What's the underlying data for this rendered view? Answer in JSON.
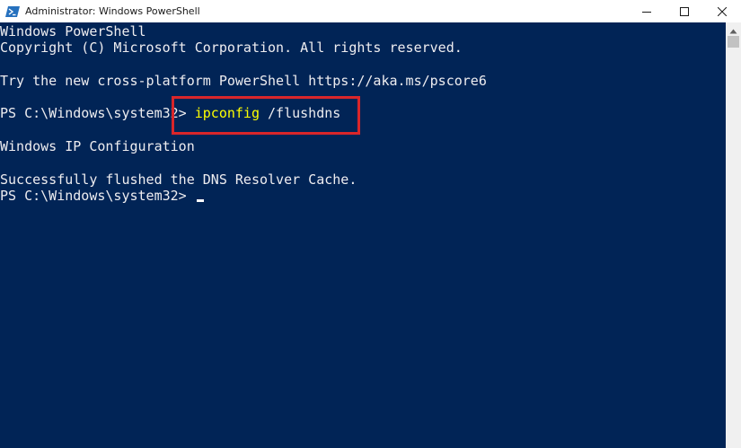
{
  "window": {
    "title": "Administrator: Windows PowerShell",
    "controls": [
      "minimize-icon",
      "maximize-icon",
      "close-icon"
    ]
  },
  "console": {
    "lines": [
      "Windows PowerShell",
      "Copyright (C) Microsoft Corporation. All rights reserved.",
      "",
      "Try the new cross-platform PowerShell https://aka.ms/pscore6",
      "",
      "",
      "",
      "Windows IP Configuration",
      "",
      "Successfully flushed the DNS Resolver Cache."
    ],
    "prompt": "PS C:\\Windows\\system32> ",
    "command_name": "ipconfig",
    "command_args": " /flushdns",
    "final_prompt": "PS C:\\Windows\\system32> "
  },
  "colors": {
    "background": "#012456",
    "text": "#eeedf0",
    "command": "#ffff00",
    "highlight": "#d9262a"
  }
}
